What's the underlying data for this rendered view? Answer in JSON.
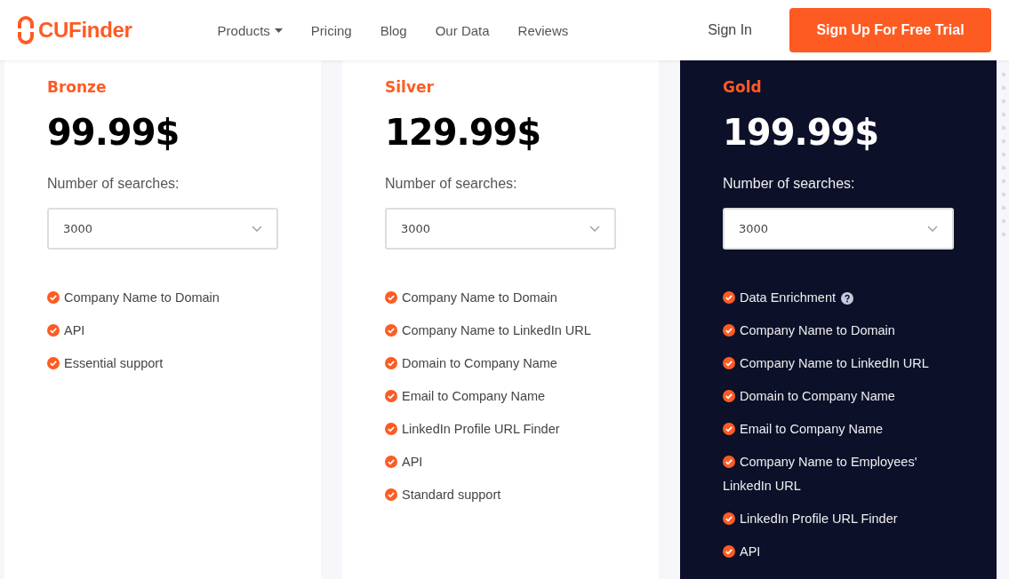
{
  "header": {
    "logo": "CUFinder",
    "nav": [
      {
        "label": "Products",
        "dropdown": true
      },
      {
        "label": "Pricing",
        "dropdown": false
      },
      {
        "label": "Blog",
        "dropdown": false
      },
      {
        "label": "Our Data",
        "dropdown": false
      },
      {
        "label": "Reviews",
        "dropdown": false
      }
    ],
    "sign_in": "Sign In",
    "cta": "Sign Up For Free Trial"
  },
  "plans": [
    {
      "name": "Bronze",
      "price": "99.99$",
      "featured": false,
      "searches_label": "Number of searches:",
      "searches_value": "3000",
      "features": [
        {
          "text": "Company Name to Domain",
          "help": false
        },
        {
          "text": "API",
          "help": false
        },
        {
          "text": "Essential support",
          "help": false
        }
      ]
    },
    {
      "name": "Silver",
      "price": "129.99$",
      "featured": false,
      "searches_label": "Number of searches:",
      "searches_value": "3000",
      "features": [
        {
          "text": "Company Name to Domain",
          "help": false
        },
        {
          "text": "Company Name to LinkedIn URL",
          "help": false
        },
        {
          "text": "Domain to Company Name",
          "help": false
        },
        {
          "text": "Email to Company Name",
          "help": false
        },
        {
          "text": "LinkedIn Profile URL Finder",
          "help": false
        },
        {
          "text": "API",
          "help": false
        },
        {
          "text": "Standard support",
          "help": false
        }
      ]
    },
    {
      "name": "Gold",
      "price": "199.99$",
      "featured": true,
      "searches_label": "Number of searches:",
      "searches_value": "3000",
      "features": [
        {
          "text": "Data Enrichment",
          "help": true
        },
        {
          "text": "Company Name to Domain",
          "help": false
        },
        {
          "text": "Company Name to LinkedIn URL",
          "help": false
        },
        {
          "text": "Domain to Company Name",
          "help": false
        },
        {
          "text": "Email to Company Name",
          "help": false
        },
        {
          "text": "Company Name to Employees' LinkedIn URL",
          "help": false
        },
        {
          "text": "LinkedIn Profile URL Finder",
          "help": false
        },
        {
          "text": "API",
          "help": false
        }
      ]
    }
  ]
}
